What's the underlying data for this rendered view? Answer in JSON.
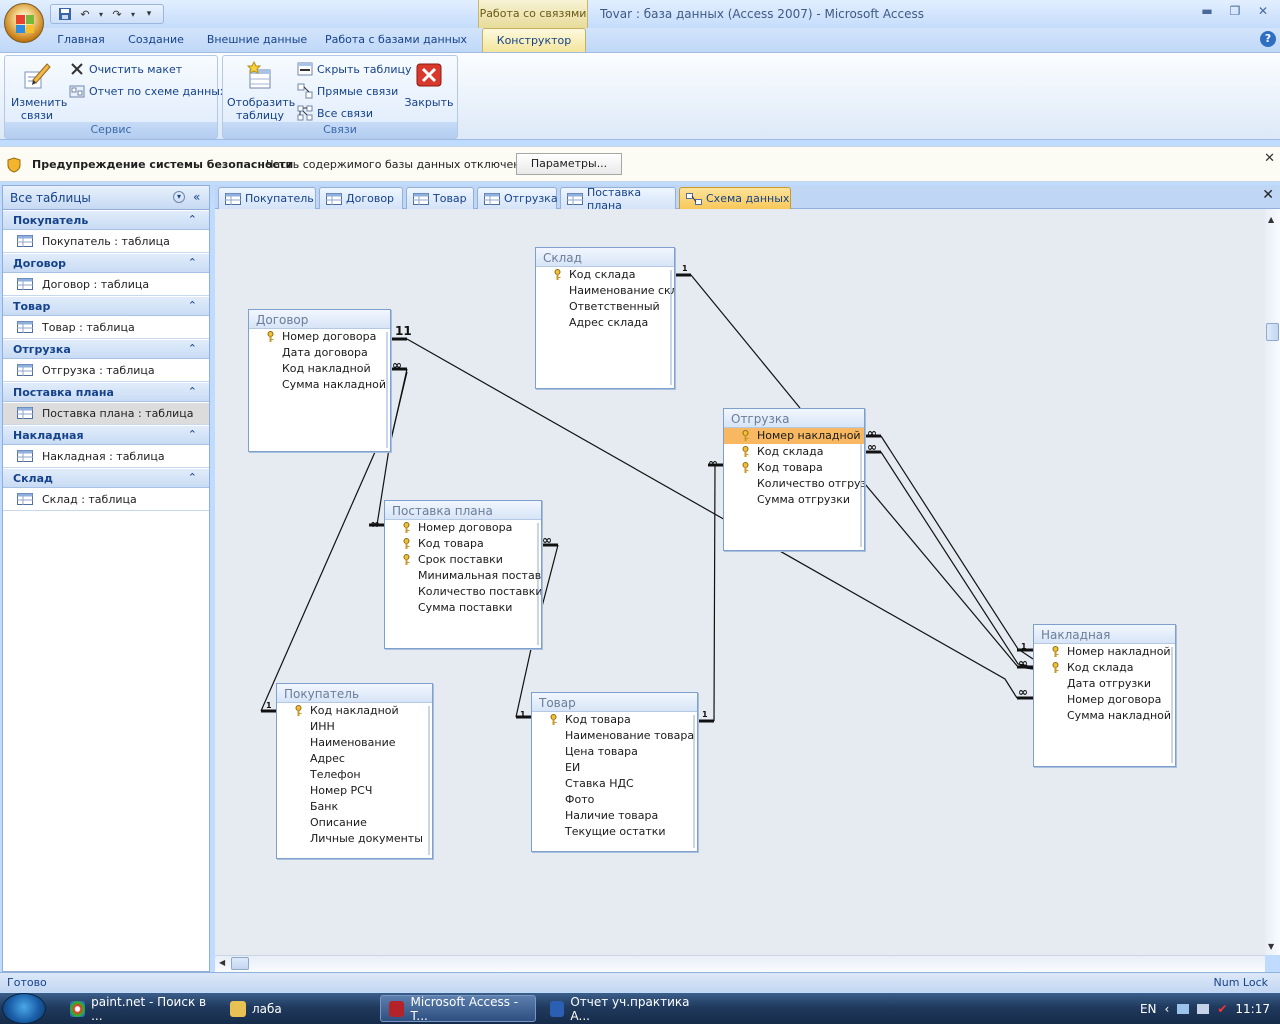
{
  "window": {
    "context_tab_header": "Работа со связями",
    "title": "Tovar : база данных (Access 2007) - Microsoft Access"
  },
  "ribbon_tabs": [
    "Главная",
    "Создание",
    "Внешние данные",
    "Работа с базами данных",
    "Конструктор"
  ],
  "ribbon": {
    "groups": {
      "service": "Сервис",
      "links": "Связи"
    },
    "edit_links": "Изменить связи",
    "clear_layout": "Очистить макет",
    "schema_report": "Отчет по схеме данных",
    "show_table": "Отобразить таблицу",
    "hide_table": "Скрыть таблицу",
    "direct_links": "Прямые связи",
    "all_links": "Все связи",
    "close": "Закрыть"
  },
  "security_bar": {
    "title": "Предупреждение системы безопасности",
    "message": "Часть содержимого базы данных отключено",
    "params_button": "Параметры..."
  },
  "nav_pane": {
    "title": "Все таблицы",
    "groups": [
      {
        "name": "Покупатель",
        "item": "Покупатель : таблица"
      },
      {
        "name": "Договор",
        "item": "Договор : таблица"
      },
      {
        "name": "Товар",
        "item": "Товар : таблица"
      },
      {
        "name": "Отгрузка",
        "item": "Отгрузка : таблица"
      },
      {
        "name": "Поставка плана",
        "item": "Поставка плана : таблица"
      },
      {
        "name": "Накладная",
        "item": "Накладная : таблица"
      },
      {
        "name": "Склад",
        "item": "Склад : таблица"
      }
    ]
  },
  "doc_tabs": [
    "Покупатель",
    "Договор",
    "Товар",
    "Отгрузка",
    "Поставка плана",
    "Схема данных"
  ],
  "tables": {
    "sklad": {
      "title": "Склад",
      "fields": [
        "Код склада",
        "Наименование склада",
        "Ответственный",
        "Адрес склада"
      ]
    },
    "dogovor": {
      "title": "Договор",
      "fields": [
        "Номер договора",
        "Дата договора",
        "Код накладной",
        "Сумма накладной"
      ]
    },
    "otgruzka": {
      "title": "Отгрузка",
      "fields": [
        "Номер накладной",
        "Код склада",
        "Код товара",
        "Количество отгрузки",
        "Сумма отгрузки"
      ]
    },
    "postavka": {
      "title": "Поставка плана",
      "fields": [
        "Номер договора",
        "Код товара",
        "Срок поставки",
        "Минимальная поставка",
        "Количество поставки",
        "Сумма поставки"
      ]
    },
    "nakladnaya": {
      "title": "Накладная",
      "fields": [
        "Номер накладной",
        "Код склада",
        "Дата отгрузки",
        "Номер договора",
        "Сумма накладной"
      ]
    },
    "pokupatel": {
      "title": "Покупатель",
      "fields": [
        "Код накладной",
        "ИНН",
        "Наименование",
        "Адрес",
        "Телефон",
        "Номер РСЧ",
        "Банк",
        "Описание",
        "Личные документы"
      ]
    },
    "tovar": {
      "title": "Товар",
      "fields": [
        "Код товара",
        "Наименование товара",
        "Цена товара",
        "ЕИ",
        "Ставка НДС",
        "Фото",
        "Наличие товара",
        "Текущие остатки"
      ]
    }
  },
  "rel_labels": {
    "one": "1",
    "many": "∞"
  },
  "status": {
    "left": "Готово",
    "right": "Num Lock"
  },
  "taskbar": {
    "items": [
      "paint.net - Поиск в ...",
      "лаба",
      "Microsoft Access - T...",
      "Отчет уч.практика А..."
    ],
    "lang": "EN",
    "time": "11:17"
  }
}
